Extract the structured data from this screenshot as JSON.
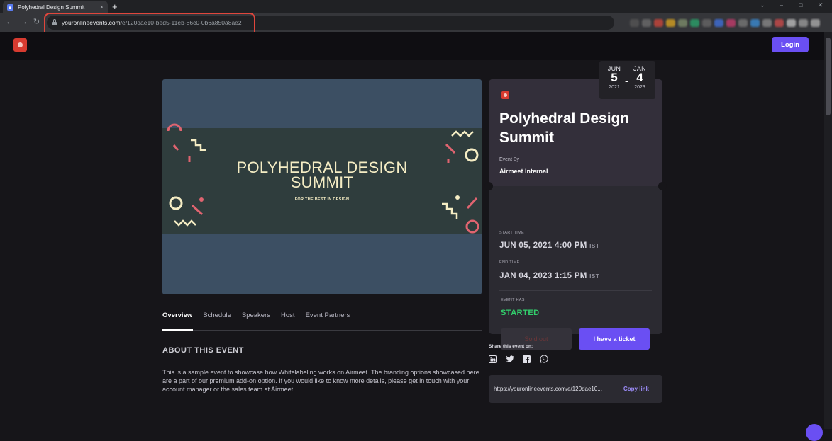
{
  "browser": {
    "tab_title": "Polyhedral Design Summit",
    "tab_close": "×",
    "new_tab": "+",
    "url_host": "youronlineevents.com",
    "url_path": "/e/120dae10-bed5-11eb-86c0-0b6a850a8ae2",
    "back": "←",
    "forward": "→",
    "reload": "↻",
    "minimize": "–",
    "maximize": "□",
    "close": "✕"
  },
  "header": {
    "login_label": "Login"
  },
  "banner": {
    "title_line1": "POLYHEDRAL DESIGN",
    "title_line2": "SUMMIT",
    "subtitle": "FOR THE BEST IN DESIGN"
  },
  "tabs": [
    "Overview",
    "Schedule",
    "Speakers",
    "Host",
    "Event Partners"
  ],
  "about": {
    "heading": "ABOUT THIS EVENT",
    "text": "This is a sample event to showcase how Whitelabeling works on Airmeet. The branding options showcased here are a part of our premium add-on option. If you would like to know more details, please get in touch with your account manager or the sales team at Airmeet."
  },
  "date_badge": {
    "start_month": "JUN",
    "start_day": "5",
    "start_year": "2021",
    "separator": "-",
    "end_month": "JAN",
    "end_day": "4",
    "end_year": "2023"
  },
  "event": {
    "title": "Polyhedral Design Summit",
    "by_label": "Event By",
    "by": "Airmeet Internal",
    "start_label": "START TIME",
    "start_time": "JUN 05, 2021 4:00 PM",
    "end_label": "END TIME",
    "end_time": "JAN 04, 2023 1:15 PM",
    "timezone": "IST",
    "status_label": "EVENT HAS",
    "status": "STARTED",
    "sold_out_label": "Sold out",
    "ticket_label": "I have a ticket"
  },
  "share": {
    "label": "Share this event on:",
    "icons": [
      "linkedin-icon",
      "twitter-icon",
      "facebook-icon",
      "whatsapp-icon"
    ],
    "link": "https://youronlineevents.com/e/120dae10...",
    "copy_label": "Copy link"
  },
  "colors": {
    "accent": "#6a4ff3",
    "brand_red": "#d83b30",
    "status_green": "#32d06d",
    "banner_bg": "#3c4f63",
    "banner_text": "#f5edc4"
  }
}
